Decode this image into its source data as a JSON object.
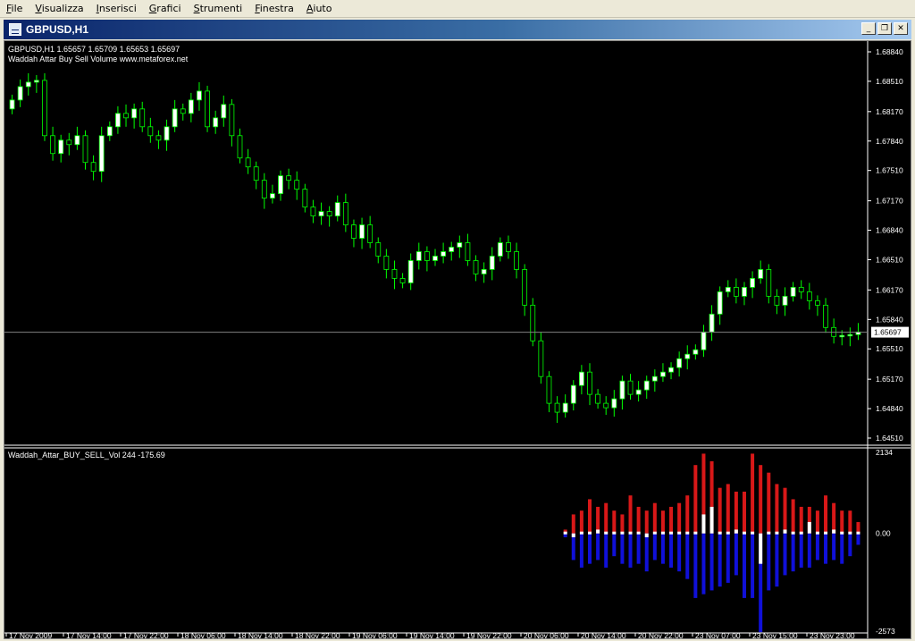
{
  "menu": [
    "File",
    "Visualizza",
    "Inserisci",
    "Grafici",
    "Strumenti",
    "Finestra",
    "Aiuto"
  ],
  "window": {
    "title": "GBPUSD,H1",
    "buttons": {
      "minimize": "_",
      "restore": "❐",
      "close": "✕"
    }
  },
  "colors": {
    "background": "#000000",
    "bull": "#ffffff",
    "bull_outline": "#00ff00",
    "bear": "#000000",
    "wick": "#00ff00",
    "axis_text": "#ffffff",
    "buy": "#d81818",
    "sell": "#1010d8",
    "net": "#ffffff",
    "price_line": "#808080"
  },
  "chart_data": [
    {
      "type": "candlestick",
      "info_line": "GBPUSD,H1  1.65657 1.65709 1.65653 1.65697",
      "indicator_label": "Waddah Attar Buy Sell Volume www.metaforex.net",
      "ylim": [
        1.6445,
        1.6888
      ],
      "y_ticks": [
        "1.68840",
        "1.68510",
        "1.68170",
        "1.67840",
        "1.67510",
        "1.67170",
        "1.66840",
        "1.66510",
        "1.66170",
        "1.65840",
        "1.65510",
        "1.65170",
        "1.64840",
        "1.64510"
      ],
      "current_price": "1.65697",
      "close": [
        1.683,
        1.6845,
        1.685,
        1.6852,
        1.679,
        1.677,
        1.6785,
        1.678,
        1.679,
        1.676,
        1.675,
        1.679,
        1.68,
        1.6815,
        1.681,
        1.682,
        1.68,
        1.679,
        1.6785,
        1.68,
        1.682,
        1.6815,
        1.683,
        1.684,
        1.68,
        1.681,
        1.6825,
        1.679,
        1.6765,
        1.6755,
        1.674,
        1.672,
        1.6725,
        1.6745,
        1.674,
        1.673,
        1.671,
        1.67,
        1.6705,
        1.67,
        1.6715,
        1.669,
        1.6675,
        1.669,
        1.667,
        1.6655,
        1.664,
        1.663,
        1.6625,
        1.665,
        1.666,
        1.665,
        1.6655,
        1.666,
        1.6665,
        1.667,
        1.665,
        1.6635,
        1.664,
        1.6655,
        1.667,
        1.666,
        1.664,
        1.66,
        1.656,
        1.652,
        1.649,
        1.648,
        1.649,
        1.651,
        1.6525,
        1.65,
        1.649,
        1.6485,
        1.6495,
        1.6515,
        1.65,
        1.6505,
        1.6515,
        1.652,
        1.6525,
        1.653,
        1.654,
        1.6545,
        1.655,
        1.657,
        1.659,
        1.6615,
        1.662,
        1.661,
        1.662,
        1.663,
        1.664,
        1.661,
        1.66,
        1.661,
        1.662,
        1.6615,
        1.6605,
        1.66,
        1.6575,
        1.6565,
        1.6566,
        1.6567,
        1.657
      ]
    },
    {
      "type": "bar",
      "label": "Waddah_Attar_BUY_SELL_Vol 244 -175.69",
      "ylim": [
        -2573,
        2134
      ],
      "y_ticks": [
        "2134",
        "0.00",
        "-2573"
      ],
      "buy": [
        100,
        500,
        600,
        900,
        700,
        800,
        600,
        500,
        1000,
        700,
        600,
        800,
        600,
        700,
        800,
        1000,
        1800,
        2100,
        1900,
        1200,
        1300,
        1100,
        1100,
        2100,
        1800,
        1600,
        1300,
        1200,
        900,
        700,
        700,
        600,
        1000,
        800,
        600,
        600,
        300
      ],
      "sell": [
        -100,
        -700,
        -900,
        -800,
        -700,
        -900,
        -600,
        -800,
        -900,
        -800,
        -1000,
        -700,
        -800,
        -900,
        -1000,
        -1200,
        -1700,
        -1600,
        -1500,
        -1400,
        -1300,
        -1100,
        -1700,
        -1700,
        -2600,
        -1500,
        -1400,
        -1100,
        -1000,
        -900,
        -900,
        -700,
        -800,
        -700,
        -800,
        -600,
        -300
      ],
      "net": [
        0,
        -100,
        0,
        0,
        100,
        0,
        0,
        0,
        0,
        0,
        -100,
        0,
        0,
        0,
        0,
        0,
        0,
        500,
        700,
        0,
        0,
        100,
        0,
        0,
        -800,
        0,
        0,
        100,
        0,
        0,
        300,
        0,
        0,
        100,
        0,
        0,
        0
      ]
    }
  ],
  "x_labels": [
    "17 Nov 2009",
    "17 Nov 14:00",
    "17 Nov 22:00",
    "18 Nov 06:00",
    "18 Nov 14:00",
    "18 Nov 22:00",
    "19 Nov 06:00",
    "19 Nov 14:00",
    "19 Nov 22:00",
    "20 Nov 06:00",
    "20 Nov 14:00",
    "20 Nov 22:00",
    "23 Nov 07:00",
    "23 Nov 15:00",
    "23 Nov 23:00"
  ]
}
